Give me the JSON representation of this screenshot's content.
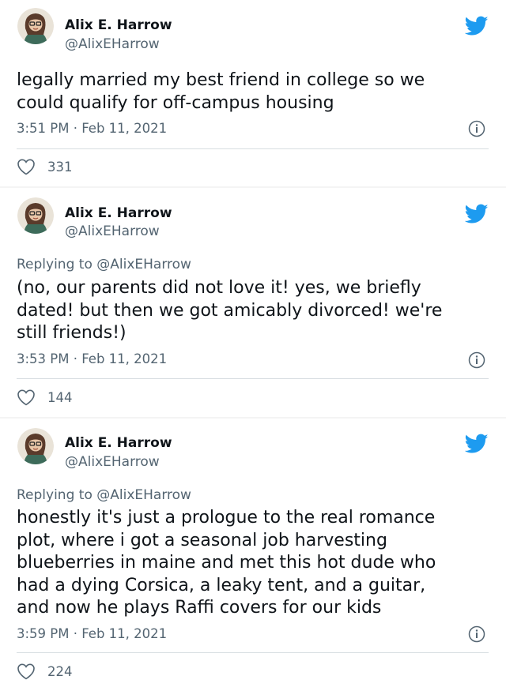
{
  "tweets": [
    {
      "author_name": "Alix E. Harrow",
      "author_handle": "@AlixEHarrow",
      "reply_prefix": "",
      "reply_handle": "",
      "text": "legally married my best friend in college so we\ncould qualify for off-campus housing",
      "timestamp": "3:51 PM · Feb 11, 2021",
      "like_count": "331"
    },
    {
      "author_name": "Alix E. Harrow",
      "author_handle": "@AlixEHarrow",
      "reply_prefix": "Replying to",
      "reply_handle": "@AlixEHarrow",
      "text": "(no, our parents did not love it! yes, we briefly\ndated! but then we got amicably divorced! we're\nstill friends!)",
      "timestamp": "3:53 PM · Feb 11, 2021",
      "like_count": "144"
    },
    {
      "author_name": "Alix E. Harrow",
      "author_handle": "@AlixEHarrow",
      "reply_prefix": "Replying to",
      "reply_handle": "@AlixEHarrow",
      "text": "honestly it's just a prologue to the real romance\nplot, where i got a seasonal job harvesting\nblueberries in maine and met this hot dude who\nhad a dying Corsica, a leaky tent, and a guitar,\nand now he plays Raffi covers for our kids",
      "timestamp": "3:59 PM · Feb 11, 2021",
      "like_count": "224"
    }
  ],
  "colors": {
    "twitter_blue": "#1d9bf0",
    "secondary_text": "#536471",
    "primary_text": "#0f1419"
  },
  "icons": [
    "avatar",
    "twitter-bird-icon",
    "info-icon",
    "heart-icon"
  ]
}
